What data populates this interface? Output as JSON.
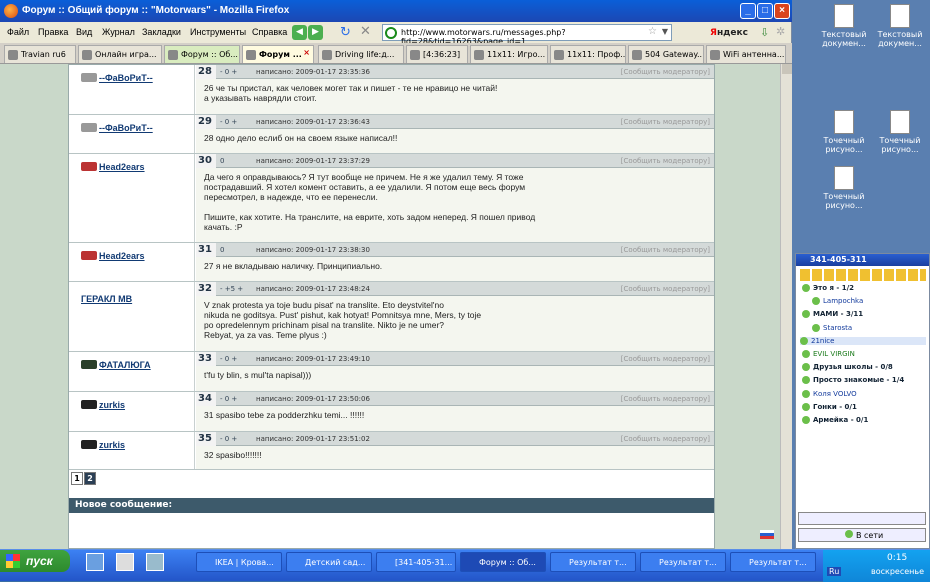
{
  "window": {
    "title": "Форум :: Общий форум :: \"Motorwars\" - Mozilla Firefox"
  },
  "menu": [
    "Файл",
    "Правка",
    "Вид",
    "Журнал",
    "Закладки",
    "Инструменты",
    "Справка"
  ],
  "address": {
    "url": "http://www.motorwars.ru/messages.php?fid=28&tid=16263&page_id=1"
  },
  "search": {
    "engine_a": "Я",
    "engine_b": "ндекс"
  },
  "tabs": [
    {
      "label": "Travian ru6"
    },
    {
      "label": "Онлайн игра..."
    },
    {
      "label": "Форум :: Об..."
    },
    {
      "label": "Форум ..."
    },
    {
      "label": "Driving life:д..."
    },
    {
      "label": "[4:36:23]"
    },
    {
      "label": "11x11: Игро..."
    },
    {
      "label": "11x11: Проф..."
    },
    {
      "label": "504 Gateway..."
    },
    {
      "label": "WiFi антенна..."
    }
  ],
  "posts": [
    {
      "num": "28",
      "author": "--ФаВоРиТ--",
      "rating": "- 0 +",
      "date": "написано: 2009-01-17 23:35:36",
      "report": "[Сообщить модератору]",
      "text": "26 че ты пристал, как человек могет так и пишет - те не нравицо не читай!\nа указывать наврядли стоит."
    },
    {
      "num": "29",
      "author": "--ФаВоРиТ--",
      "rating": "- 0 +",
      "date": "написано: 2009-01-17 23:36:43",
      "report": "[Сообщить модератору]",
      "text": "28 одно дело еслиб он на своем языке написал!!"
    },
    {
      "num": "30",
      "author": "Head2ears",
      "rating": "0",
      "date": "написано: 2009-01-17 23:37:29",
      "report": "[Сообщить модератору]",
      "text": "Да чего я оправдываюсь? Я тут вообще не причем. Не я же удалил тему. Я тоже\nпострадавший. Я хотел комент оставить, а ее удалили. Я потом еще весь форум\nпересмотрел, в надежде, что ее перенесли.\n\nПишите, как хотите. На транслите, на еврите, хоть задом неперед. Я пошел привод\nкачать. :P"
    },
    {
      "num": "31",
      "author": "Head2ears",
      "rating": "0",
      "date": "написано: 2009-01-17 23:38:30",
      "report": "[Сообщить модератору]",
      "text": "27 я не вкладываю наличку. Принципиально."
    },
    {
      "num": "32",
      "author": "ГЕРАКЛ МВ",
      "rating": "- +5 +",
      "date": "написано: 2009-01-17 23:48:24",
      "report": "[Сообщить модератору]",
      "text": "V znak protesta ya toje budu pisat' na translite. Eto deystvitel'no\nnikuda ne goditsya. Pust' pishut, kak hotyat! Pomnitsya mne, Mers, ty toje\npo opredelennym prichinam pisal na translite. Nikto je ne umer?\nRebyat, ya za vas. Teme plyus :)"
    },
    {
      "num": "33",
      "author": "ФАТАЛЮГА",
      "rating": "- 0 +",
      "date": "написано: 2009-01-17 23:49:10",
      "report": "[Сообщить модератору]",
      "text": "t'fu ty blin, s mul'ta napisal)))"
    },
    {
      "num": "34",
      "author": "zurkis",
      "rating": "- 0 +",
      "date": "написано: 2009-01-17 23:50:06",
      "report": "[Сообщить модератору]",
      "text": "31 spasibo tebe za podderzhku temi... !!!!!!"
    },
    {
      "num": "35",
      "author": "zurkis",
      "rating": "- 0 +",
      "date": "написано: 2009-01-17 23:51:02",
      "report": "[Сообщить модератору]",
      "text": "32 spasibo!!!!!!!"
    }
  ],
  "pager": [
    "1",
    "2"
  ],
  "new_message": "Новое сообщение:",
  "desktop": [
    {
      "label": "Текстовый докумен..."
    },
    {
      "label": "Текстовый докумен..."
    },
    {
      "label": "Точечный рисуно..."
    },
    {
      "label": "Точечный рисуно..."
    },
    {
      "label": "Точечный рисуно..."
    }
  ],
  "icq": {
    "title": "341-405-311",
    "rows": [
      {
        "t": "Это я - 1/2",
        "k": "grp"
      },
      {
        "t": "Lampochka",
        "k": "user"
      },
      {
        "t": "МАМИ - 3/11",
        "k": "grp"
      },
      {
        "t": "Starosta",
        "k": "user"
      },
      {
        "t": "21nice",
        "k": "user"
      },
      {
        "t": "EVIL VIRGIN",
        "k": "user"
      },
      {
        "t": "Друзья школы - 0/8",
        "k": "grp"
      },
      {
        "t": "Просто знакомые - 1/4",
        "k": "grp"
      },
      {
        "t": "Коля VOLVO",
        "k": "user"
      },
      {
        "t": "Гонки - 0/1",
        "k": "grp"
      },
      {
        "t": "Армейка - 0/1",
        "k": "grp"
      }
    ],
    "status": "В сети"
  },
  "taskbar": {
    "start": "пуск",
    "items": [
      {
        "label": "IKEA | Крова..."
      },
      {
        "label": "Детский сад..."
      },
      {
        "label": "[341-405-31..."
      },
      {
        "label": "Форум :: Об..."
      },
      {
        "label": "Результат т..."
      },
      {
        "label": "Результат т..."
      },
      {
        "label": "Результат т..."
      }
    ],
    "lang": "Ru",
    "time": "0:15",
    "day": "воскресенье"
  }
}
